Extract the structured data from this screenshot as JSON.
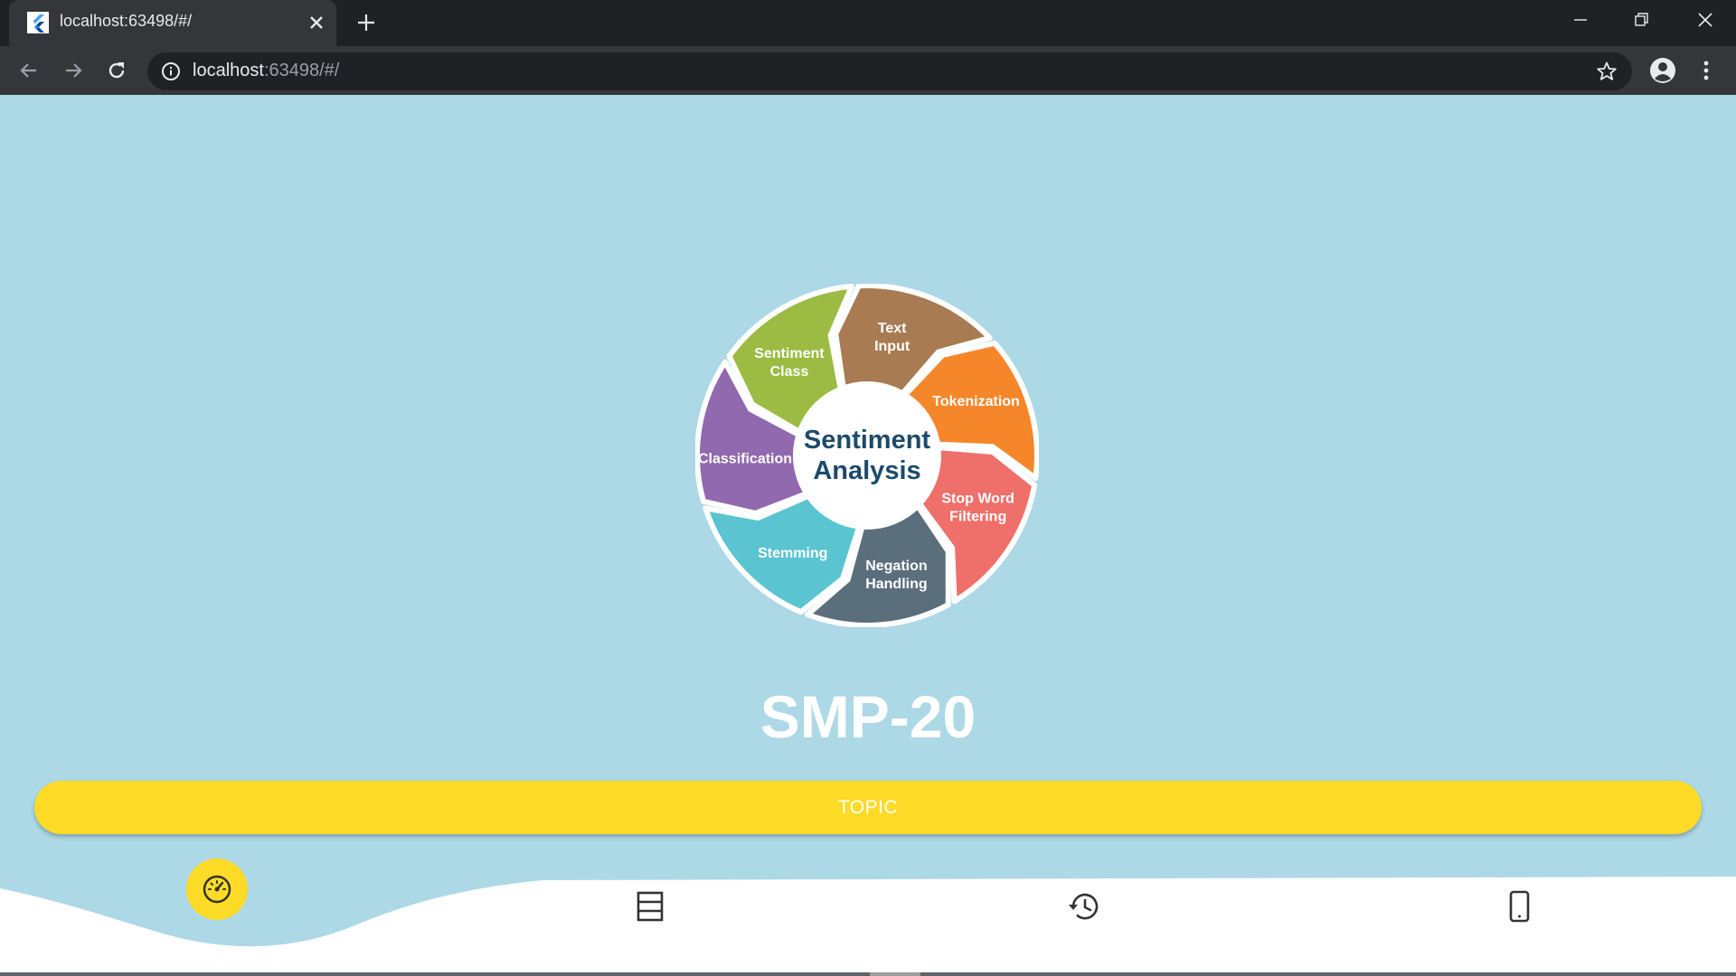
{
  "browser": {
    "tab_title": "localhost:63498/#/",
    "url_host": "localhost",
    "url_rest": ":63498/#/"
  },
  "logo": {
    "center_line1": "Sentiment",
    "center_line2": "Analysis",
    "segments": [
      {
        "line1": "Text",
        "line2": "Input",
        "color": "#a87b52"
      },
      {
        "line1": "Tokenization",
        "line2": "",
        "color": "#f5872a"
      },
      {
        "line1": "Stop Word",
        "line2": "Filtering",
        "color": "#ef6f6a"
      },
      {
        "line1": "Negation",
        "line2": "Handling",
        "color": "#5a6e7c"
      },
      {
        "line1": "Stemming",
        "line2": "",
        "color": "#5bc4d1"
      },
      {
        "line1": "Classification",
        "line2": "",
        "color": "#9169ae"
      },
      {
        "line1": "Sentiment",
        "line2": "Class",
        "color": "#9bbb43"
      }
    ],
    "center_text_color": "#1d4a6b"
  },
  "main": {
    "title": "SMP-20",
    "topic_button": "TOPIC"
  },
  "bottom_nav": {
    "items": [
      {
        "icon": "speedometer-icon",
        "active": true
      },
      {
        "icon": "list-icon",
        "active": false
      },
      {
        "icon": "history-icon",
        "active": false
      },
      {
        "icon": "phone-icon",
        "active": false
      }
    ],
    "accent": "#fddb26",
    "background": "#add8e6"
  }
}
